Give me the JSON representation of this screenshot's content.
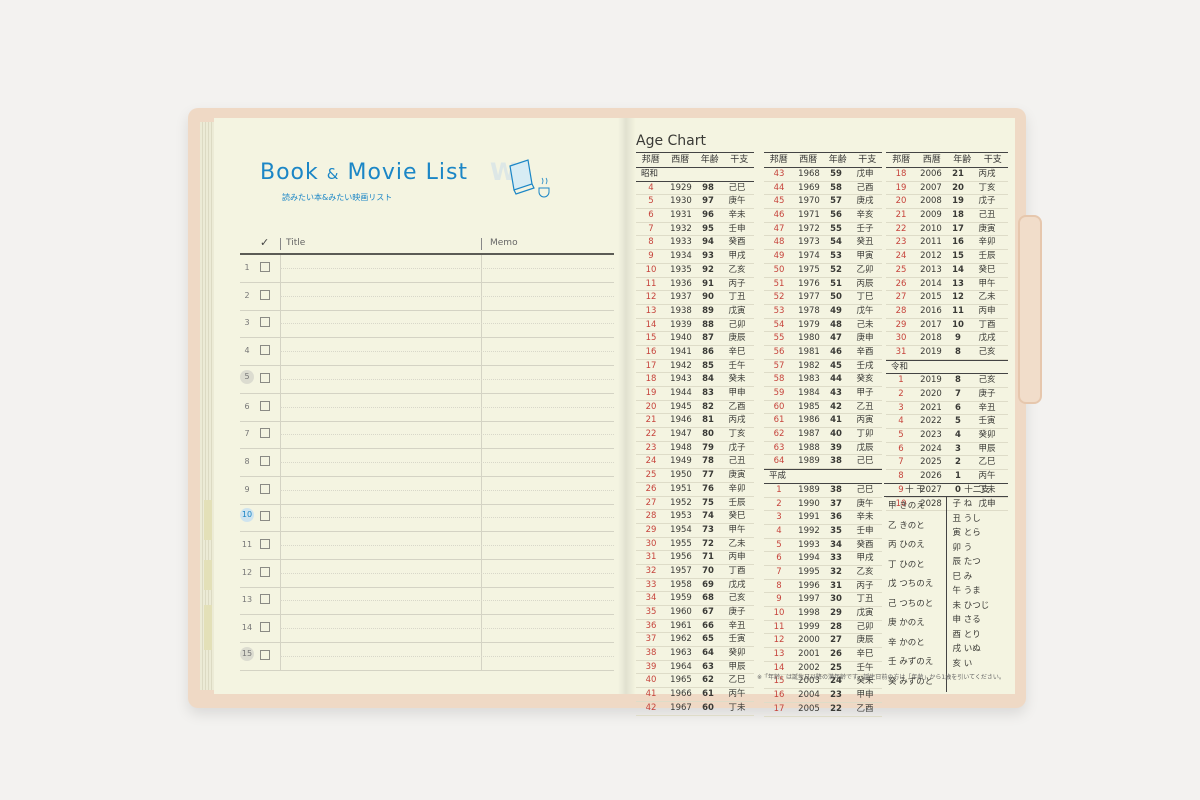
{
  "book_movie": {
    "title_word1": "Book",
    "title_amp": "&",
    "title_word2": "Movie List",
    "subtitle": "読みたい本&みたい映画リスト",
    "header_check": "✓",
    "header_title": "Title",
    "header_memo": "Memo",
    "rows": [
      "1",
      "2",
      "3",
      "4",
      "5",
      "6",
      "7",
      "8",
      "9",
      "10",
      "11",
      "12",
      "13",
      "14",
      "15"
    ]
  },
  "age_chart": {
    "title": "Age Chart",
    "headers": [
      "邦暦",
      "西暦",
      "年齢",
      "干支"
    ],
    "col1": {
      "era": "昭和",
      "rows": [
        [
          "4",
          "1929",
          "98",
          "己巳"
        ],
        [
          "5",
          "1930",
          "97",
          "庚午"
        ],
        [
          "6",
          "1931",
          "96",
          "辛未"
        ],
        [
          "7",
          "1932",
          "95",
          "壬申"
        ],
        [
          "8",
          "1933",
          "94",
          "癸酉"
        ],
        [
          "9",
          "1934",
          "93",
          "甲戌"
        ],
        [
          "10",
          "1935",
          "92",
          "乙亥"
        ],
        [
          "11",
          "1936",
          "91",
          "丙子"
        ],
        [
          "12",
          "1937",
          "90",
          "丁丑"
        ],
        [
          "13",
          "1938",
          "89",
          "戊寅"
        ],
        [
          "14",
          "1939",
          "88",
          "己卯"
        ],
        [
          "15",
          "1940",
          "87",
          "庚辰"
        ],
        [
          "16",
          "1941",
          "86",
          "辛巳"
        ],
        [
          "17",
          "1942",
          "85",
          "壬午"
        ],
        [
          "18",
          "1943",
          "84",
          "癸未"
        ],
        [
          "19",
          "1944",
          "83",
          "甲申"
        ],
        [
          "20",
          "1945",
          "82",
          "乙酉"
        ],
        [
          "21",
          "1946",
          "81",
          "丙戌"
        ],
        [
          "22",
          "1947",
          "80",
          "丁亥"
        ],
        [
          "23",
          "1948",
          "79",
          "戊子"
        ],
        [
          "24",
          "1949",
          "78",
          "己丑"
        ],
        [
          "25",
          "1950",
          "77",
          "庚寅"
        ],
        [
          "26",
          "1951",
          "76",
          "辛卯"
        ],
        [
          "27",
          "1952",
          "75",
          "壬辰"
        ],
        [
          "28",
          "1953",
          "74",
          "癸巳"
        ],
        [
          "29",
          "1954",
          "73",
          "甲午"
        ],
        [
          "30",
          "1955",
          "72",
          "乙未"
        ],
        [
          "31",
          "1956",
          "71",
          "丙申"
        ],
        [
          "32",
          "1957",
          "70",
          "丁酉"
        ],
        [
          "33",
          "1958",
          "69",
          "戊戌"
        ],
        [
          "34",
          "1959",
          "68",
          "己亥"
        ],
        [
          "35",
          "1960",
          "67",
          "庚子"
        ],
        [
          "36",
          "1961",
          "66",
          "辛丑"
        ],
        [
          "37",
          "1962",
          "65",
          "壬寅"
        ],
        [
          "38",
          "1963",
          "64",
          "癸卯"
        ],
        [
          "39",
          "1964",
          "63",
          "甲辰"
        ],
        [
          "40",
          "1965",
          "62",
          "乙巳"
        ],
        [
          "41",
          "1966",
          "61",
          "丙午"
        ],
        [
          "42",
          "1967",
          "60",
          "丁未"
        ]
      ]
    },
    "col2": {
      "rows_a": [
        [
          "43",
          "1968",
          "59",
          "戊申"
        ],
        [
          "44",
          "1969",
          "58",
          "己酉"
        ],
        [
          "45",
          "1970",
          "57",
          "庚戌"
        ],
        [
          "46",
          "1971",
          "56",
          "辛亥"
        ],
        [
          "47",
          "1972",
          "55",
          "壬子"
        ],
        [
          "48",
          "1973",
          "54",
          "癸丑"
        ],
        [
          "49",
          "1974",
          "53",
          "甲寅"
        ],
        [
          "50",
          "1975",
          "52",
          "乙卯"
        ],
        [
          "51",
          "1976",
          "51",
          "丙辰"
        ],
        [
          "52",
          "1977",
          "50",
          "丁巳"
        ],
        [
          "53",
          "1978",
          "49",
          "戊午"
        ],
        [
          "54",
          "1979",
          "48",
          "己未"
        ],
        [
          "55",
          "1980",
          "47",
          "庚申"
        ],
        [
          "56",
          "1981",
          "46",
          "辛酉"
        ],
        [
          "57",
          "1982",
          "45",
          "壬戌"
        ],
        [
          "58",
          "1983",
          "44",
          "癸亥"
        ],
        [
          "59",
          "1984",
          "43",
          "甲子"
        ],
        [
          "60",
          "1985",
          "42",
          "乙丑"
        ],
        [
          "61",
          "1986",
          "41",
          "丙寅"
        ],
        [
          "62",
          "1987",
          "40",
          "丁卯"
        ],
        [
          "63",
          "1988",
          "39",
          "戊辰"
        ],
        [
          "64",
          "1989",
          "38",
          "己巳"
        ]
      ],
      "era": "平成",
      "rows_b": [
        [
          "1",
          "1989",
          "38",
          "己巳"
        ],
        [
          "2",
          "1990",
          "37",
          "庚午"
        ],
        [
          "3",
          "1991",
          "36",
          "辛未"
        ],
        [
          "4",
          "1992",
          "35",
          "壬申"
        ],
        [
          "5",
          "1993",
          "34",
          "癸酉"
        ],
        [
          "6",
          "1994",
          "33",
          "甲戌"
        ],
        [
          "7",
          "1995",
          "32",
          "乙亥"
        ],
        [
          "8",
          "1996",
          "31",
          "丙子"
        ],
        [
          "9",
          "1997",
          "30",
          "丁丑"
        ],
        [
          "10",
          "1998",
          "29",
          "戊寅"
        ],
        [
          "11",
          "1999",
          "28",
          "己卯"
        ],
        [
          "12",
          "2000",
          "27",
          "庚辰"
        ],
        [
          "13",
          "2001",
          "26",
          "辛巳"
        ],
        [
          "14",
          "2002",
          "25",
          "壬午"
        ],
        [
          "15",
          "2003",
          "24",
          "癸未"
        ],
        [
          "16",
          "2004",
          "23",
          "甲申"
        ],
        [
          "17",
          "2005",
          "22",
          "乙酉"
        ]
      ]
    },
    "col3": {
      "rows_a": [
        [
          "18",
          "2006",
          "21",
          "丙戌"
        ],
        [
          "19",
          "2007",
          "20",
          "丁亥"
        ],
        [
          "20",
          "2008",
          "19",
          "戊子"
        ],
        [
          "21",
          "2009",
          "18",
          "己丑"
        ],
        [
          "22",
          "2010",
          "17",
          "庚寅"
        ],
        [
          "23",
          "2011",
          "16",
          "辛卯"
        ],
        [
          "24",
          "2012",
          "15",
          "壬辰"
        ],
        [
          "25",
          "2013",
          "14",
          "癸巳"
        ],
        [
          "26",
          "2014",
          "13",
          "甲午"
        ],
        [
          "27",
          "2015",
          "12",
          "乙未"
        ],
        [
          "28",
          "2016",
          "11",
          "丙申"
        ],
        [
          "29",
          "2017",
          "10",
          "丁酉"
        ],
        [
          "30",
          "2018",
          "9",
          "戊戌"
        ],
        [
          "31",
          "2019",
          "8",
          "己亥"
        ]
      ],
      "era": "令和",
      "rows_b": [
        [
          "1",
          "2019",
          "8",
          "己亥"
        ],
        [
          "2",
          "2020",
          "7",
          "庚子"
        ],
        [
          "3",
          "2021",
          "6",
          "辛丑"
        ],
        [
          "4",
          "2022",
          "5",
          "壬寅"
        ],
        [
          "5",
          "2023",
          "4",
          "癸卯"
        ],
        [
          "6",
          "2024",
          "3",
          "甲辰"
        ],
        [
          "7",
          "2025",
          "2",
          "乙巳"
        ],
        [
          "8",
          "2026",
          "1",
          "丙午"
        ],
        [
          "9",
          "2027",
          "0",
          "丁未"
        ],
        [
          "10",
          "2028",
          "",
          "戊申"
        ]
      ]
    },
    "jikkan_header": "十 干",
    "junishi_header": "十二支",
    "jikkan": [
      "甲 きのえ",
      "乙 きのと",
      "丙 ひのえ",
      "丁 ひのと",
      "戊 つちのえ",
      "己 つちのと",
      "庚 かのえ",
      "辛 かのと",
      "壬 みずのえ",
      "癸 みずのと"
    ],
    "junishi": [
      "子 ね",
      "丑 うし",
      "寅 とら",
      "卯 う",
      "辰 たつ",
      "巳 み",
      "午 うま",
      "未 ひつじ",
      "申 さる",
      "酉 とり",
      "戌 いぬ",
      "亥 い"
    ],
    "footnote": "※「年齢」は誕生日以降の満年齢です。誕生日前の方は「年齢」から1歳を引いてください。"
  }
}
